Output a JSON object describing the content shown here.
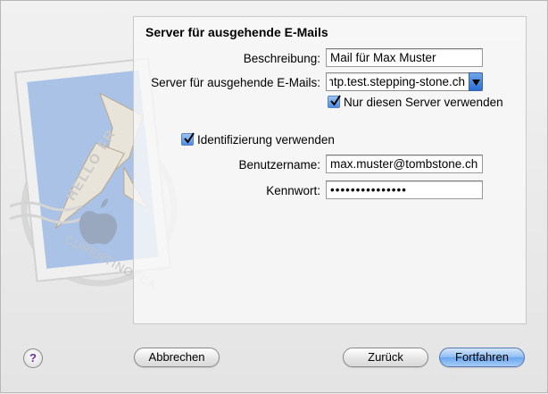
{
  "panel": {
    "title": "Server für ausgehende E-Mails"
  },
  "form": {
    "description_label": "Beschreibung:",
    "description_value": "Mail für Max Muster",
    "server_label": "Server für ausgehende E-Mails:",
    "server_value": "smtp.test.stepping-stone.ch",
    "only_server_label": "Nur diesen Server verwenden",
    "only_server_checked": true,
    "use_auth_label": "Identifizierung verwenden",
    "use_auth_checked": true,
    "username_label": "Benutzername:",
    "username_value": "max.muster@tombstone.ch",
    "password_label": "Kennwort:",
    "password_value": "•••••••••••••••"
  },
  "buttons": {
    "help": "?",
    "cancel": "Abbrechen",
    "back": "Zurück",
    "continue": "Fortfahren"
  },
  "stamp": {
    "text_top": "HELLO FR",
    "text_bottom": "CUPERTINO, CA"
  },
  "colors": {
    "accent": "#4d8de3",
    "stamp_blue": "#9db7dd"
  }
}
